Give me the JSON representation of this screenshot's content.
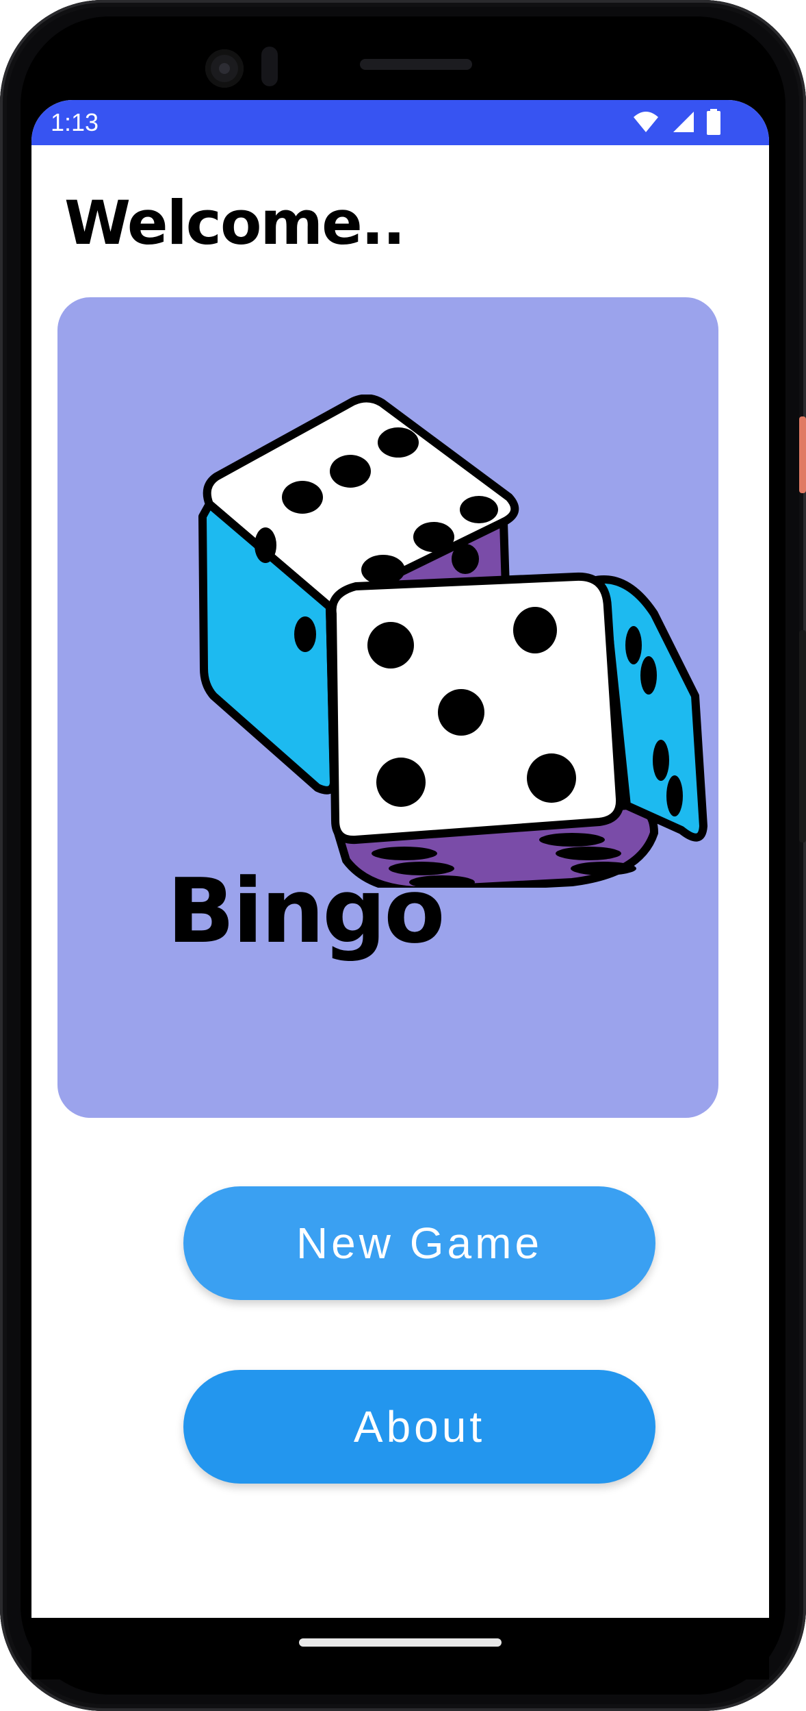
{
  "status_bar": {
    "time": "1:13",
    "icons": [
      "wifi-icon",
      "cellular-signal-icon",
      "battery-icon"
    ],
    "color": "#3754f2"
  },
  "home": {
    "welcome_text": "Welcome..",
    "card_title": "Bingo",
    "card_color": "#9ba3ec"
  },
  "buttons": {
    "new_game": "New Game",
    "about": "About",
    "color": "#3aa0f2"
  }
}
